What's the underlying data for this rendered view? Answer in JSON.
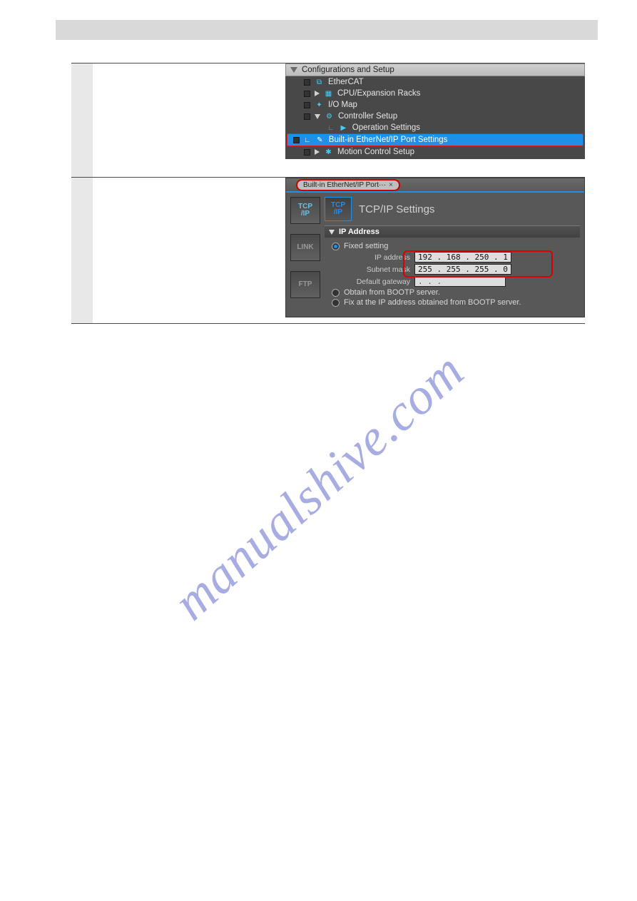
{
  "tree": {
    "header": "Configurations and Setup",
    "items": [
      {
        "label": "EtherCAT"
      },
      {
        "label": "CPU/Expansion Racks"
      },
      {
        "label": "I/O Map"
      },
      {
        "label": "Controller Setup"
      },
      {
        "label": "Operation Settings"
      },
      {
        "label": "Built-in EtherNet/IP Port Settings"
      },
      {
        "label": "Motion Control Setup"
      }
    ]
  },
  "ip": {
    "tab_label": "Built-in EtherNet/IP Port···",
    "side": {
      "tcpip": "TCP\n/IP",
      "link": "LINK",
      "ftp": "FTP"
    },
    "title_icon": "TCP\n/IP",
    "title_text": "TCP/IP Settings",
    "section_header": "IP Address",
    "radios": {
      "fixed": "Fixed setting",
      "bootp": "Obtain from BOOTP server.",
      "fix_bootp": "Fix at the IP address obtained from BOOTP server."
    },
    "fields": {
      "ip_label": "IP address",
      "ip_value": "192 . 168 . 250 .    1",
      "mask_label": "Subnet mask",
      "mask_value": "255 . 255 . 255 .    0",
      "gw_label": "Default gateway",
      "gw_value": "   .    .    .   "
    }
  },
  "watermark": "manualshive.com"
}
